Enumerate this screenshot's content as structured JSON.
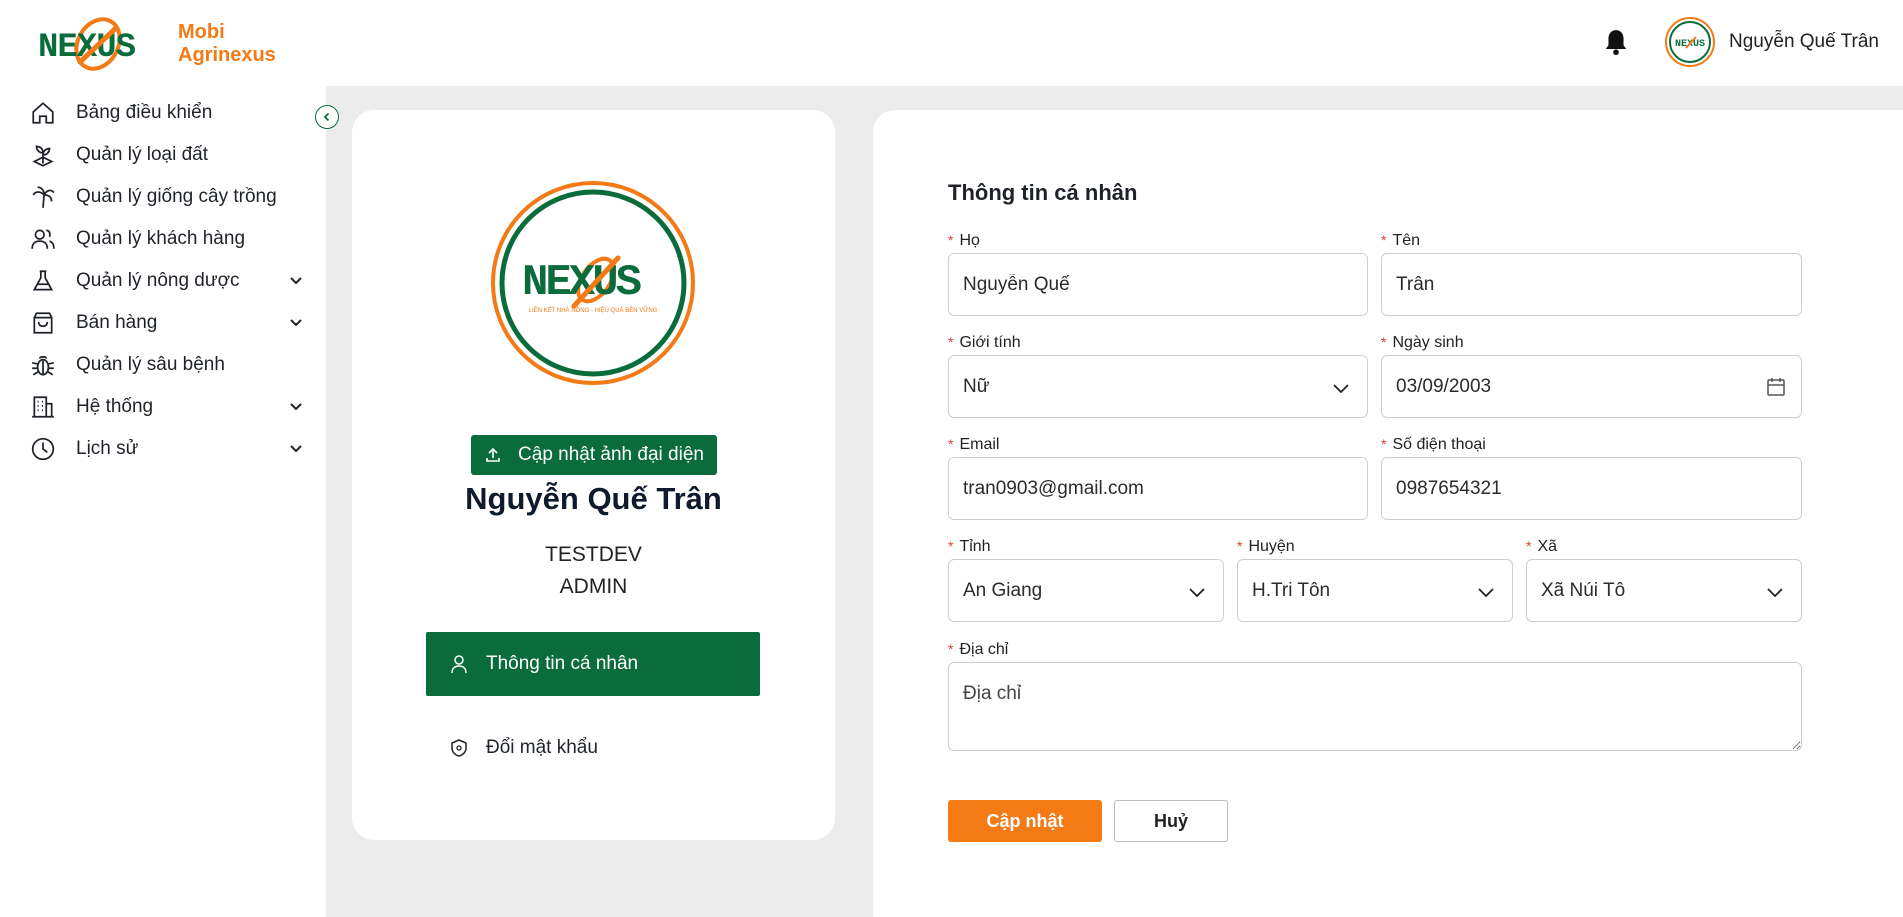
{
  "app": {
    "logo_text": "NEXUS",
    "brand_line1": "Mobi",
    "brand_line2": "Agrinexus"
  },
  "header": {
    "user_name": "Nguyễn Quế Trân"
  },
  "sidebar": {
    "items": [
      {
        "label": "Bảng điều khiển",
        "icon": "home-icon"
      },
      {
        "label": "Quản lý loại đất",
        "icon": "sprout-icon"
      },
      {
        "label": "Quản lý giống cây trồng",
        "icon": "palm-icon"
      },
      {
        "label": "Quản lý khách hàng",
        "icon": "users-icon"
      },
      {
        "label": "Quản lý nông dược",
        "icon": "flask-icon",
        "expandable": true
      },
      {
        "label": "Bán hàng",
        "icon": "bag-icon",
        "expandable": true
      },
      {
        "label": "Quản lý sâu bệnh",
        "icon": "bug-icon"
      },
      {
        "label": "Hệ thống",
        "icon": "building-icon",
        "expandable": true
      },
      {
        "label": "Lịch sử",
        "icon": "clock-icon",
        "expandable": true
      }
    ]
  },
  "profile": {
    "upload_label": "Cập nhật ảnh đại diện",
    "name": "Nguyễn Quế Trân",
    "org": "TESTDEV",
    "role": "ADMIN",
    "logo_tagline": "LIÊN KẾT NHÀ NÔNG - HIỆU QUẢ BỀN VỮNG",
    "tabs": [
      {
        "label": "Thông tin cá nhân",
        "active": true,
        "icon": "user-icon"
      },
      {
        "label": "Đổi mật khẩu",
        "active": false,
        "icon": "shield-icon"
      }
    ]
  },
  "form": {
    "title": "Thông tin cá nhân",
    "last_name": {
      "label": "Họ",
      "value": "Nguyễn Quế"
    },
    "first_name": {
      "label": "Tên",
      "value": "Trân"
    },
    "gender": {
      "label": "Giới tính",
      "value": "Nữ"
    },
    "birthday": {
      "label": "Ngày sinh",
      "value": "03/09/2003"
    },
    "email": {
      "label": "Email",
      "value": "tran0903@gmail.com"
    },
    "phone": {
      "label": "Số điện thoại",
      "value": "0987654321"
    },
    "province": {
      "label": "Tỉnh",
      "value": "An Giang"
    },
    "district": {
      "label": "Huyện",
      "value": "H.Tri Tôn"
    },
    "ward": {
      "label": "Xã",
      "value": "Xã Núi Tô"
    },
    "address": {
      "label": "Địa chỉ",
      "placeholder": "Địa chỉ"
    },
    "required_mark": "*",
    "submit_label": "Cập nhật",
    "cancel_label": "Huỷ"
  },
  "colors": {
    "primary_green": "#0a6b3b",
    "accent_orange": "#f47a16",
    "background": "#ececec"
  }
}
